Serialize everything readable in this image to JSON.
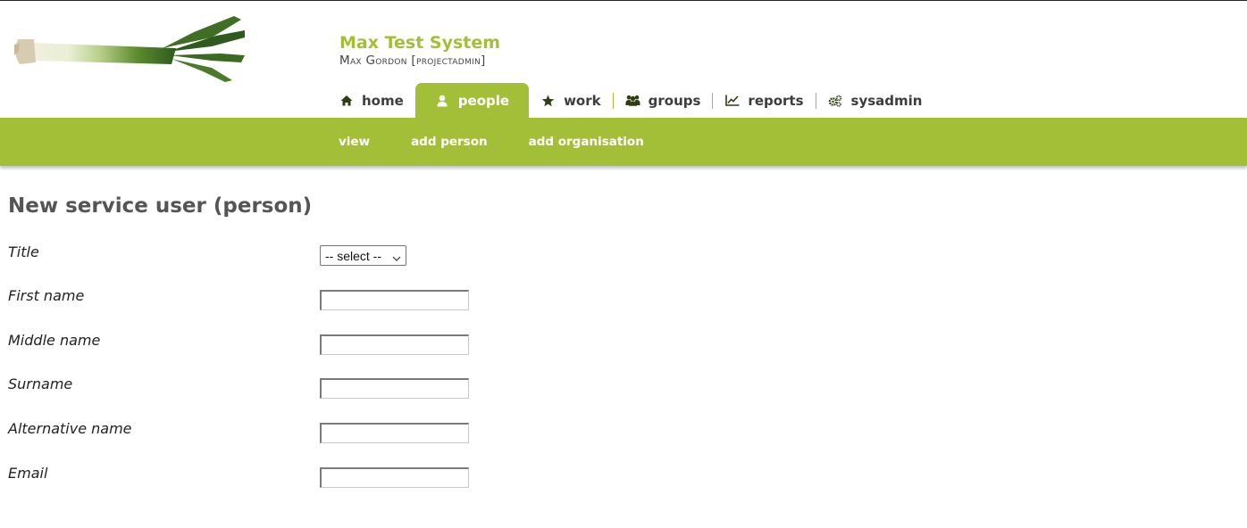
{
  "header": {
    "system_title": "Max Test System",
    "user_line": "Max Gordon [projectadmin]"
  },
  "nav": {
    "tabs": [
      {
        "label": "home",
        "icon": "home-icon"
      },
      {
        "label": "people",
        "icon": "user-icon",
        "active": true
      },
      {
        "label": "work",
        "icon": "star-icon"
      },
      {
        "label": "groups",
        "icon": "users-icon"
      },
      {
        "label": "reports",
        "icon": "line-chart-icon"
      },
      {
        "label": "sysadmin",
        "icon": "cogs-icon"
      }
    ]
  },
  "subnav": {
    "items": [
      {
        "label": "view"
      },
      {
        "label": "add person"
      },
      {
        "label": "add organisation"
      }
    ]
  },
  "page": {
    "title": "New service user (person)"
  },
  "form": {
    "title_label": "Title",
    "title_select_value": "-- select --",
    "first_name_label": "First name",
    "first_name_value": "",
    "middle_name_label": "Middle name",
    "middle_name_value": "",
    "surname_label": "Surname",
    "surname_value": "",
    "alt_name_label": "Alternative name",
    "alt_name_value": "",
    "email_label": "Email",
    "email_value": ""
  },
  "colors": {
    "accent": "#a3bf38",
    "nav_text": "#3d3d3d",
    "icon_dark": "#2e3d12"
  }
}
